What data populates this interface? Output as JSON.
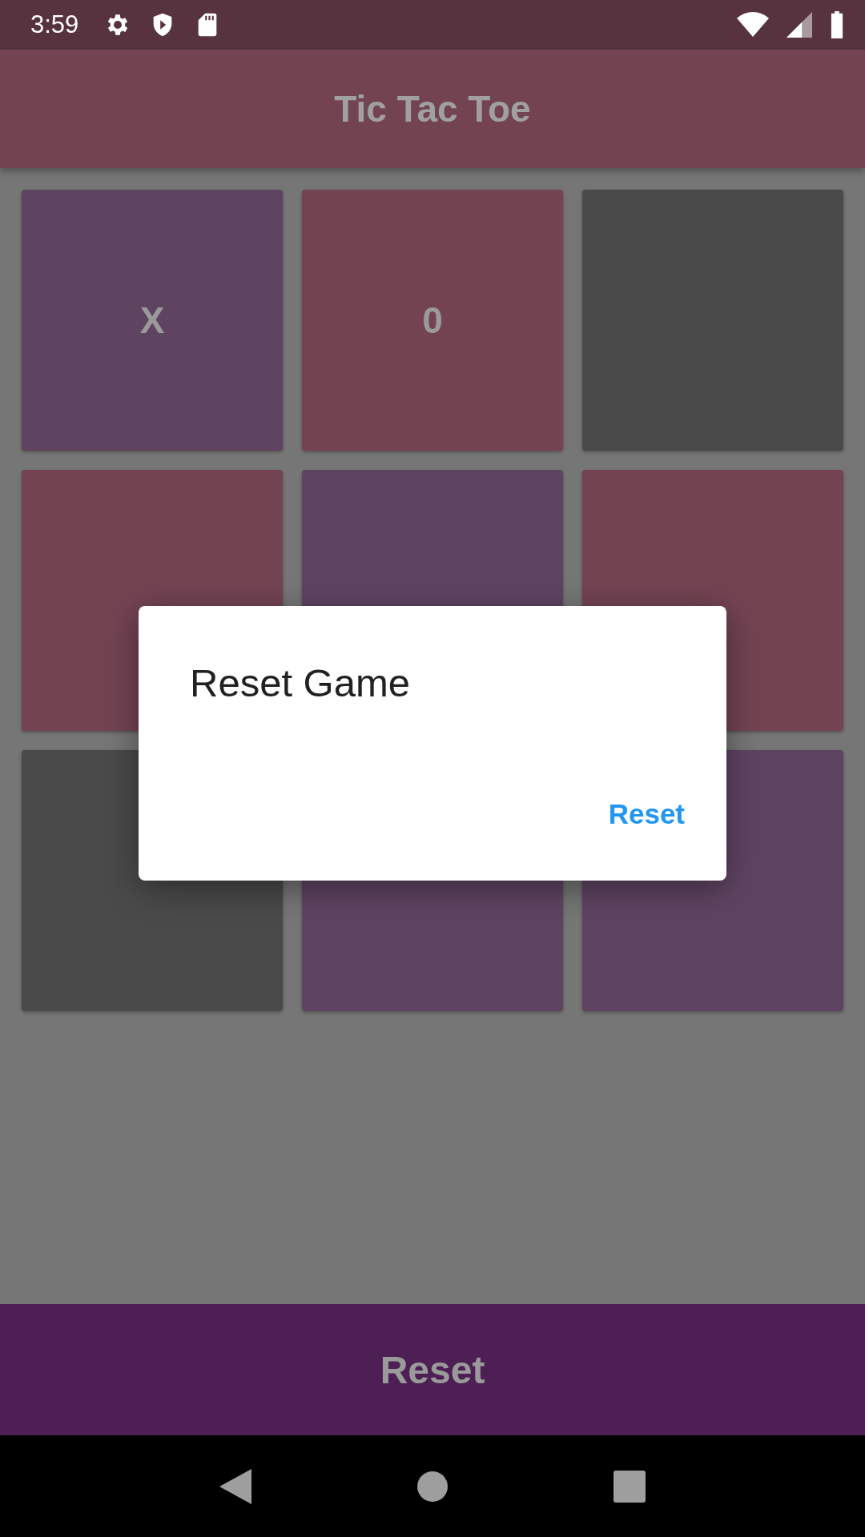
{
  "status_bar": {
    "time": "3:59"
  },
  "app_bar": {
    "title": "Tic Tac Toe"
  },
  "board": [
    {
      "mark": "X",
      "color": "#5f4462"
    },
    {
      "mark": "0",
      "color": "#734352"
    },
    {
      "color": "#4a4a4a"
    },
    {
      "color": "#734352"
    },
    {
      "color": "#5f4462"
    },
    {
      "color": "#734352"
    },
    {
      "color": "#4a4a4a"
    },
    {
      "color": "#5f4462"
    },
    {
      "color": "#5f4462"
    }
  ],
  "reset_button": "Reset",
  "dialog": {
    "title": "Reset Game",
    "action": "Reset"
  }
}
